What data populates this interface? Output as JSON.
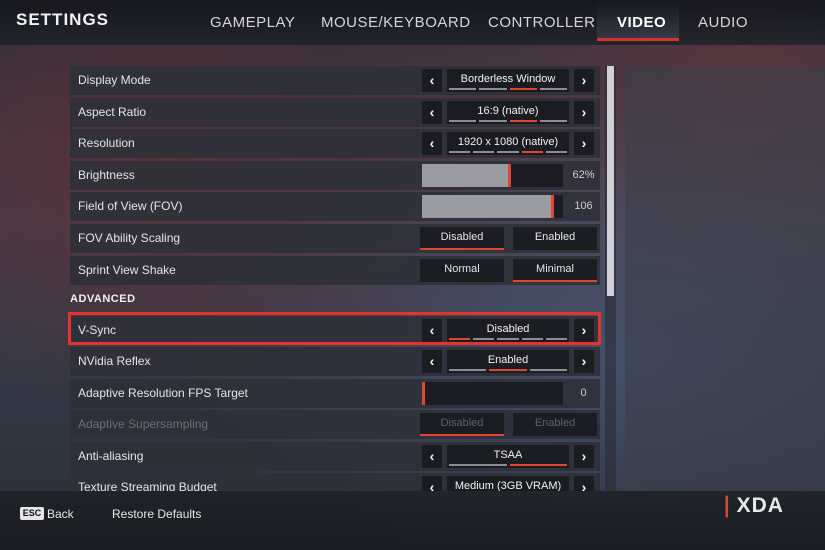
{
  "header": {
    "title": "SETTINGS",
    "tabs": [
      {
        "label": "GAMEPLAY",
        "active": false
      },
      {
        "label": "MOUSE/KEYBOARD",
        "active": false
      },
      {
        "label": "CONTROLLER",
        "active": false
      },
      {
        "label": "VIDEO",
        "active": true
      },
      {
        "label": "AUDIO",
        "active": false
      }
    ]
  },
  "settings": {
    "display_mode": {
      "label": "Display Mode",
      "value": "Borderless Window",
      "pip_index": 3,
      "pip_count": 4
    },
    "aspect_ratio": {
      "label": "Aspect Ratio",
      "value": "16:9 (native)",
      "pip_index": 3,
      "pip_count": 4
    },
    "resolution": {
      "label": "Resolution",
      "value": "1920 x 1080 (native)",
      "pip_index": 4,
      "pip_count": 5
    },
    "brightness": {
      "label": "Brightness",
      "value": "62%",
      "level": 0.62
    },
    "fov": {
      "label": "Field of View (FOV)",
      "value": "106",
      "level": 0.92
    },
    "fov_scaling": {
      "label": "FOV Ability Scaling",
      "option_1": "Disabled",
      "option_2": "Enabled",
      "selected": 1
    },
    "sprint_shake": {
      "label": "Sprint View Shake",
      "option_1": "Normal",
      "option_2": "Minimal",
      "selected": 2
    },
    "advanced_label": "ADVANCED",
    "vsync": {
      "label": "V-Sync",
      "value": "Disabled",
      "pip_index": 1,
      "pip_count": 5
    },
    "nvidia_reflex": {
      "label": "NVidia Reflex",
      "value": "Enabled",
      "pip_index": 2,
      "pip_count": 3
    },
    "adaptive_res": {
      "label": "Adaptive Resolution FPS Target",
      "value": "0",
      "level": 0.0
    },
    "adaptive_ss": {
      "label": "Adaptive Supersampling",
      "option_1": "Disabled",
      "option_2": "Enabled",
      "selected": 1
    },
    "anti_aliasing": {
      "label": "Anti-aliasing",
      "value": "TSAA",
      "pip_index": 2,
      "pip_count": 2
    },
    "texture_budget": {
      "label": "Texture Streaming Budget",
      "value": "Medium (3GB VRAM)",
      "pip_index": 3,
      "pip_count": 5
    }
  },
  "footer": {
    "esc_key": "ESC",
    "back": "Back",
    "restore": "Restore Defaults",
    "brand": "XDA"
  },
  "colors": {
    "accent": "#e0452f",
    "highlight": "#e8322c"
  }
}
